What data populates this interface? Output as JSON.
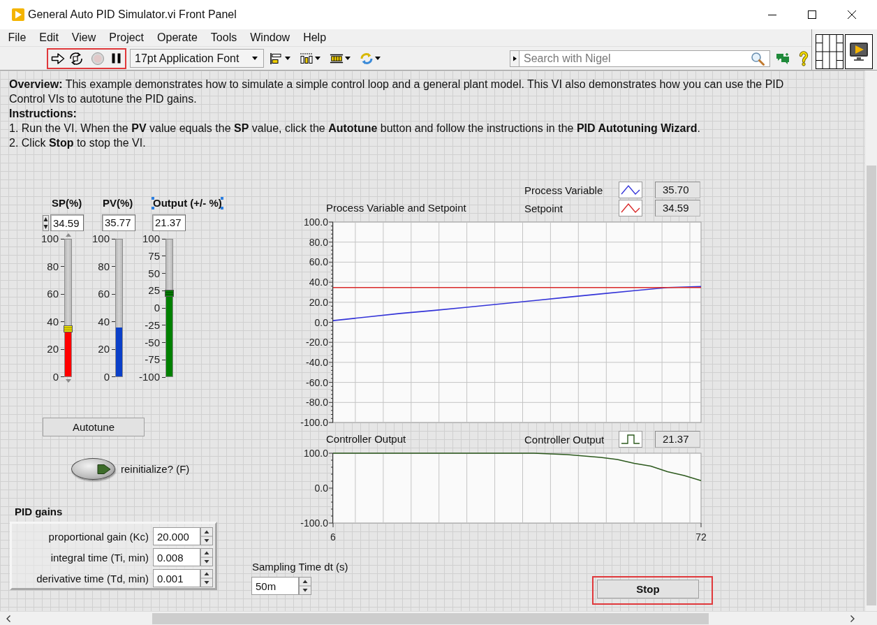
{
  "window": {
    "title": "General Auto PID Simulator.vi Front Panel"
  },
  "menu": [
    "File",
    "Edit",
    "View",
    "Project",
    "Operate",
    "Tools",
    "Window",
    "Help"
  ],
  "toolbar": {
    "run_controls_highlighted": true,
    "abort_disabled": true,
    "font": "17pt Application Font",
    "search": {
      "placeholder": "Search with Nigel"
    }
  },
  "description": {
    "overview": "**Overview:** This example demonstrates how to simulate a simple control loop and a general plant model. This VI also demonstrates how you can use the PID Control VIs to autotune the PID gains.",
    "instructions_heading": "Instructions:",
    "steps": [
      "1. Run the VI. When the **PV** value equals the **SP** value, click the **Autotune** button and follow the instructions in the **PID Autotuning Wizard**.",
      "2. Click **Stop** to stop the VI."
    ]
  },
  "sliders": [
    {
      "label": "SP(%)",
      "selected": false,
      "kind": "control",
      "value": "34.59",
      "scale": [
        "100",
        "80",
        "60",
        "40",
        "20",
        "0"
      ],
      "level": 0.3459,
      "color": "#ff0000",
      "thumb": true
    },
    {
      "label": "PV(%)",
      "selected": false,
      "kind": "indicator",
      "value": "35.77",
      "scale": [
        "100",
        "80",
        "60",
        "40",
        "20",
        "0"
      ],
      "level": 0.3577,
      "color": "#0a3fc8",
      "thumb": false
    },
    {
      "label": "Output (+/- %)",
      "selected": true,
      "kind": "indicator",
      "value": "21.37",
      "scale": [
        "100",
        "75",
        "50",
        "25",
        "0",
        "-25",
        "-50",
        "-75",
        "-100"
      ],
      "level": 0.6069,
      "color": "#008000",
      "thumb": true
    }
  ],
  "autotune": {
    "label": "Autotune"
  },
  "reinitialize": {
    "label": "reinitialize? (F)",
    "on": false
  },
  "pid_gains": {
    "title": "PID gains",
    "rows": [
      {
        "label": "proportional gain (Kc)",
        "value": "20.000"
      },
      {
        "label": "integral time (Ti, min)",
        "value": "0.008"
      },
      {
        "label": "derivative time (Td, min)",
        "value": "0.001"
      }
    ]
  },
  "sampling_time": {
    "label": "Sampling Time dt (s)",
    "value": "50m"
  },
  "process_chart": {
    "readouts": [
      "35.70",
      "34.59"
    ],
    "stepped": false,
    "horizontal_grid": true,
    "chart_data": {
      "type": "line",
      "title": "Process Variable and Setpoint",
      "x": [
        6,
        12,
        18,
        24,
        30,
        36,
        42,
        48,
        54,
        60,
        66,
        72
      ],
      "series": [
        {
          "name": "Process Variable",
          "color": "#3434d8",
          "values": [
            1.7,
            5.2,
            8.8,
            11.8,
            15.0,
            18.3,
            21.6,
            25.0,
            28.3,
            31.6,
            34.6,
            35.7
          ]
        },
        {
          "name": "Setpoint",
          "color": "#d82828",
          "values": [
            34.6,
            34.6,
            34.6,
            34.6,
            34.6,
            34.6,
            34.6,
            34.6,
            34.6,
            34.6,
            34.6,
            34.6
          ]
        }
      ],
      "xlim": [
        6,
        72
      ],
      "ylim": [
        -100,
        100
      ],
      "grid": true,
      "yticks": [
        {
          "value": 100,
          "label": "100.0"
        },
        {
          "value": 80,
          "label": "80.0"
        },
        {
          "value": 60,
          "label": "60.0"
        },
        {
          "value": 40,
          "label": "40.0"
        },
        {
          "value": 20,
          "label": "20.0"
        },
        {
          "value": 0,
          "label": "0.0"
        },
        {
          "value": -20,
          "label": "-20.0"
        },
        {
          "value": -40,
          "label": "-40.0"
        },
        {
          "value": -60,
          "label": "-60.0"
        },
        {
          "value": -80,
          "label": "-80.0"
        },
        {
          "value": -100,
          "label": "-100.0"
        }
      ]
    }
  },
  "output_chart": {
    "readouts": [
      "21.37"
    ],
    "stepped": true,
    "horizontal_grid": false,
    "chart_data": {
      "type": "line",
      "title": "Controller Output",
      "x": [
        6,
        9,
        12,
        15,
        18,
        21,
        24,
        27,
        30,
        33,
        36,
        39,
        42,
        45,
        48,
        51,
        54,
        57,
        60,
        63,
        66,
        69,
        72
      ],
      "series": [
        {
          "name": "Controller Output",
          "color": "#2d5a1e",
          "values": [
            100,
            100,
            100,
            100,
            100,
            100,
            100,
            100,
            100,
            100,
            100,
            100,
            100,
            98,
            96,
            92,
            88,
            82,
            71,
            63,
            47,
            36,
            21.4
          ]
        }
      ],
      "xlim": [
        6,
        72
      ],
      "ylim": [
        -100,
        100
      ],
      "grid": true,
      "xticks": [
        6,
        72
      ],
      "yticks": [
        {
          "value": 100,
          "label": "100.0"
        },
        {
          "value": 0,
          "label": "0.0"
        },
        {
          "value": -100,
          "label": "-100.0"
        }
      ]
    }
  },
  "stop": {
    "label": "Stop",
    "highlighted": true
  }
}
